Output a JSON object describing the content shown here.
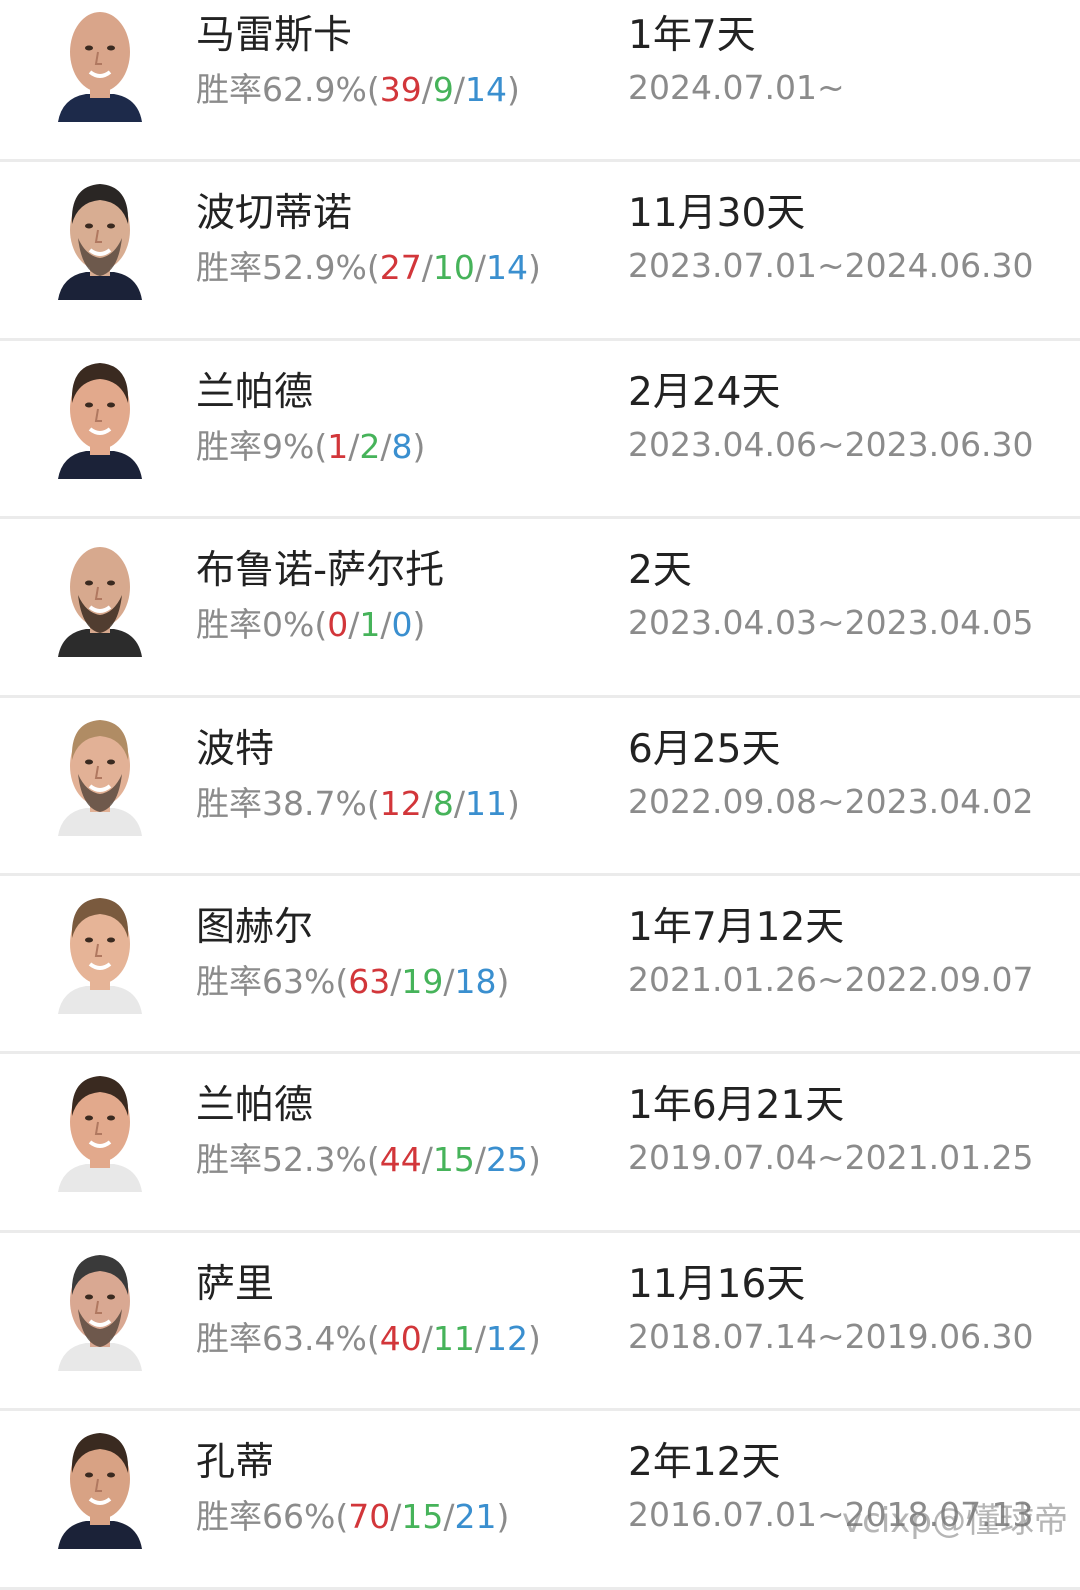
{
  "coaches": [
    {
      "name": "马雷斯卡",
      "winrate_prefix": "胜率62.9%(",
      "wins": "39",
      "draws": "9",
      "losses": "14",
      "suffix": ")",
      "tenure": "1年7天",
      "period": "2024.07.01~",
      "skin": "#d9a58a",
      "hair": "#d9a58a",
      "shirt": "#1d2a4a",
      "bald": true,
      "beard": false
    },
    {
      "name": "波切蒂诺",
      "winrate_prefix": "胜率52.9%(",
      "wins": "27",
      "draws": "10",
      "losses": "14",
      "suffix": ")",
      "tenure": "11月30天",
      "period": "2023.07.01~2024.06.30",
      "skin": "#d8ad92",
      "hair": "#2a2624",
      "shirt": "#1b2238",
      "bald": false,
      "beard": true
    },
    {
      "name": "兰帕德",
      "winrate_prefix": "胜率9%(",
      "wins": "1",
      "draws": "2",
      "losses": "8",
      "suffix": ")",
      "tenure": "2月24天",
      "period": "2023.04.06~2023.06.30",
      "skin": "#e2a98c",
      "hair": "#3a2a20",
      "shirt": "#1b2238",
      "bald": false,
      "beard": false
    },
    {
      "name": "布鲁诺-萨尔托",
      "winrate_prefix": "胜率0%(",
      "wins": "0",
      "draws": "1",
      "losses": "0",
      "suffix": ")",
      "tenure": "2天",
      "period": "2023.04.03~2023.04.05",
      "skin": "#d7a98e",
      "hair": "#d7a98e",
      "shirt": "#2c2c2c",
      "bald": true,
      "beard": true
    },
    {
      "name": "波特",
      "winrate_prefix": "胜率38.7%(",
      "wins": "12",
      "draws": "8",
      "losses": "11",
      "suffix": ")",
      "tenure": "6月25天",
      "period": "2022.09.08~2023.04.02",
      "skin": "#e2b196",
      "hair": "#b08c64",
      "shirt": "#e8e8e8",
      "bald": false,
      "beard": true
    },
    {
      "name": "图赫尔",
      "winrate_prefix": "胜率63%(",
      "wins": "63",
      "draws": "19",
      "losses": "18",
      "suffix": ")",
      "tenure": "1年7月12天",
      "period": "2021.01.26~2022.09.07",
      "skin": "#e6b497",
      "hair": "#7a5a3e",
      "shirt": "#e8e8e8",
      "bald": false,
      "beard": false
    },
    {
      "name": "兰帕德",
      "winrate_prefix": "胜率52.3%(",
      "wins": "44",
      "draws": "15",
      "losses": "25",
      "suffix": ")",
      "tenure": "1年6月21天",
      "period": "2019.07.04~2021.01.25",
      "skin": "#e2a98c",
      "hair": "#3a2a20",
      "shirt": "#e8e8e8",
      "bald": false,
      "beard": false
    },
    {
      "name": "萨里",
      "winrate_prefix": "胜率63.4%(",
      "wins": "40",
      "draws": "11",
      "losses": "12",
      "suffix": ")",
      "tenure": "11月16天",
      "period": "2018.07.14~2019.06.30",
      "skin": "#d9a892",
      "hair": "#3a3a3a",
      "shirt": "#e8e8e8",
      "bald": false,
      "beard": true
    },
    {
      "name": "孔蒂",
      "winrate_prefix": "胜率66%(",
      "wins": "70",
      "draws": "15",
      "losses": "21",
      "suffix": ")",
      "tenure": "2年12天",
      "period": "2016.07.01~2018.07.13",
      "skin": "#d8a284",
      "hair": "#3a2a20",
      "shirt": "#1b2238",
      "bald": false,
      "beard": false
    }
  ],
  "watermark": "vcixp@懂球帝"
}
